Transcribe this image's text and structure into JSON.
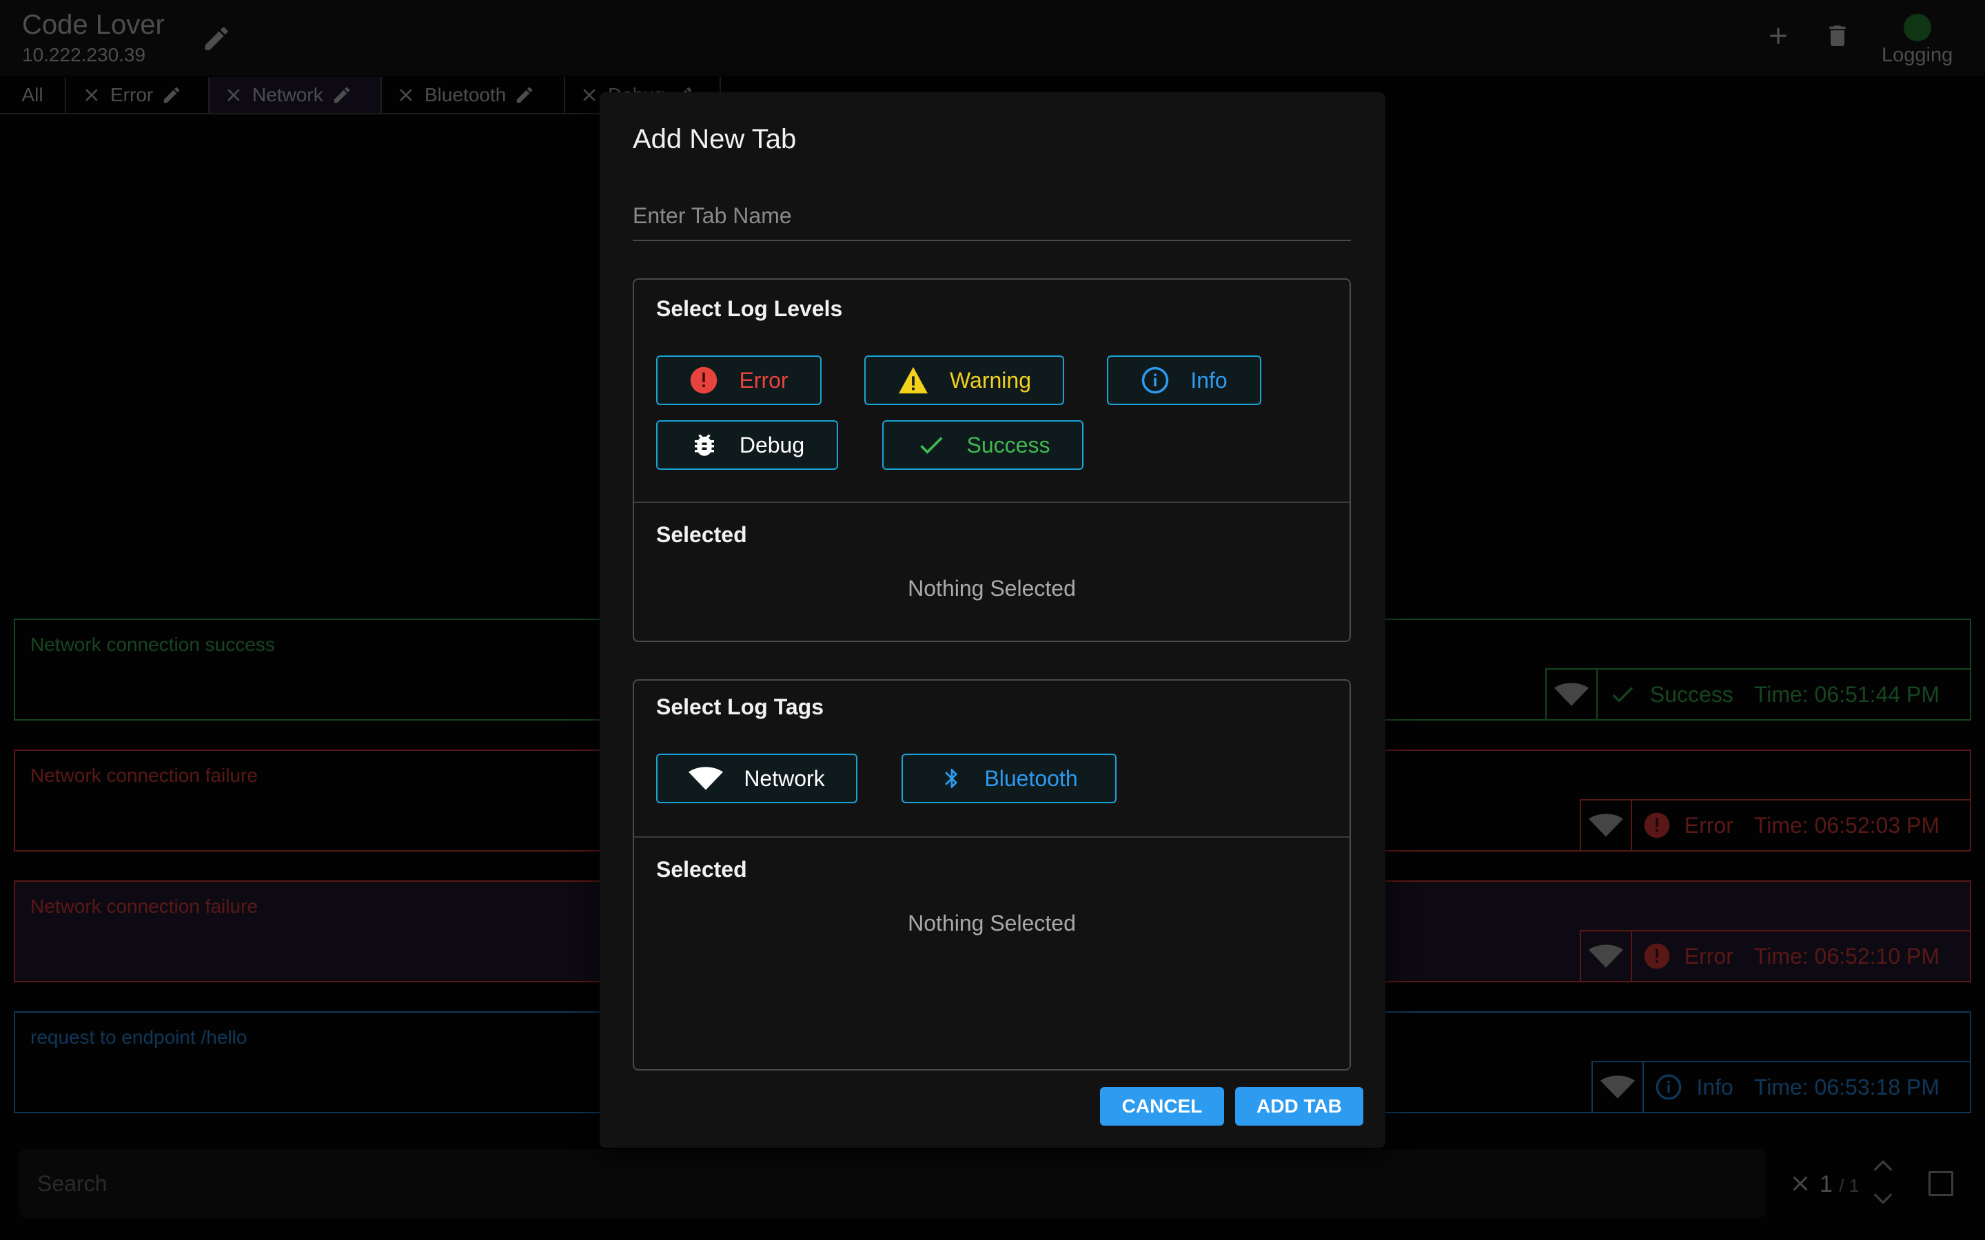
{
  "header": {
    "title": "Code Lover",
    "ip": "10.222.230.39",
    "logging_label": "Logging",
    "logging_dot_color": "#1e6b2a"
  },
  "tabs": [
    {
      "label": "All",
      "closable": false,
      "editable": false
    },
    {
      "label": "Error",
      "closable": true,
      "editable": true
    },
    {
      "label": "Network",
      "closable": true,
      "editable": true,
      "active": true
    },
    {
      "label": "Bluetooth",
      "closable": true,
      "editable": true
    },
    {
      "label": "Debug",
      "closable": true,
      "editable": true
    }
  ],
  "logs": [
    {
      "message": "Network connection success",
      "level": "Success",
      "time": "Time: 06:51:44 PM",
      "tag": "wifi-icon",
      "color": "#2e8b3e"
    },
    {
      "message": "Network connection failure",
      "level": "Error",
      "time": "Time: 06:52:03 PM",
      "tag": "wifi-icon",
      "color": "#b3302c"
    },
    {
      "message": "Network connection failure",
      "level": "Error",
      "time": "Time: 06:52:10 PM",
      "tag": "wifi-icon",
      "color": "#b3302c",
      "highlighted": true
    },
    {
      "message": "request to endpoint /hello",
      "level": "Info",
      "time": "Time: 06:53:18 PM",
      "tag": "wifi-icon",
      "color": "#1f6fb3"
    }
  ],
  "search": {
    "placeholder": "Search",
    "match_current": "1",
    "match_total": "/ 1"
  },
  "dialog": {
    "title": "Add New Tab",
    "name_placeholder": "Enter Tab Name",
    "levels_title": "Select Log Levels",
    "levels": [
      {
        "label": "Error",
        "icon": "error-icon",
        "color": "#e8433c"
      },
      {
        "label": "Warning",
        "icon": "warning-icon",
        "color": "#f2d21c"
      },
      {
        "label": "Info",
        "icon": "info-icon",
        "color": "#2d9bf0"
      },
      {
        "label": "Debug",
        "icon": "bug-icon",
        "color": "#ffffff"
      },
      {
        "label": "Success",
        "icon": "check-icon",
        "color": "#3fb950"
      }
    ],
    "levels_selected_title": "Selected",
    "levels_selected_empty": "Nothing Selected",
    "tags_title": "Select Log Tags",
    "tags": [
      {
        "label": "Network",
        "icon": "wifi-icon",
        "color": "#ffffff"
      },
      {
        "label": "Bluetooth",
        "icon": "bluetooth-icon",
        "color": "#2d9bf0"
      }
    ],
    "tags_selected_title": "Selected",
    "tags_selected_empty": "Nothing Selected",
    "cancel_label": "CANCEL",
    "add_label": "ADD TAB",
    "accent_color": "#2d9bf0",
    "chip_border_color": "#1aa3d6"
  }
}
